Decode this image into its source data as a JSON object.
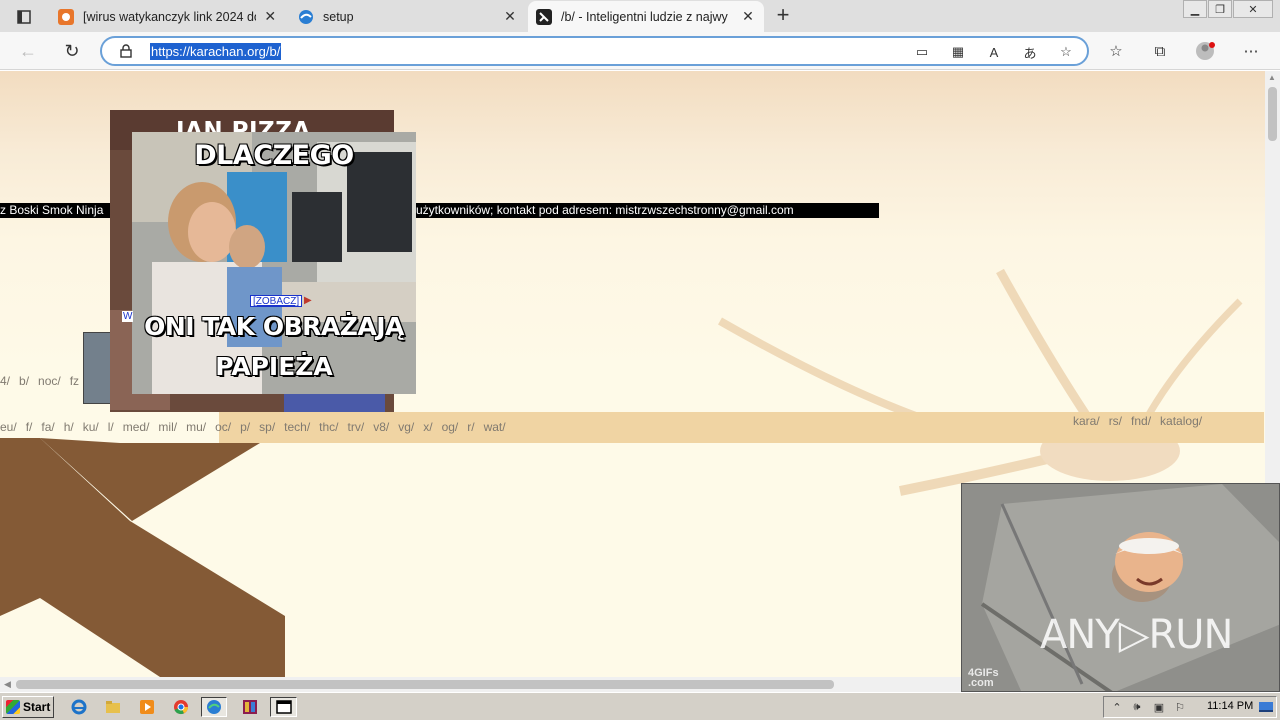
{
  "browser": {
    "tabs": [
      {
        "title": "[wirus watykanczyk link 2024 do",
        "active": false
      },
      {
        "title": "setup",
        "active": false
      },
      {
        "title": "/b/ - Inteligentni ludzie z najwy",
        "active": true
      }
    ],
    "new_tab_label": "+",
    "address": "https://karachan.org/b/"
  },
  "page": {
    "banner_left": "z Boski Smok Ninja",
    "banner_right": "użytkowników; kontakt pod adresem: mistrzwszechstronny@gmail.com",
    "nav_row1": [
      "4/",
      "b/",
      "noc/",
      "fz"
    ],
    "nav_row2": [
      "eu/",
      "f/",
      "fa/",
      "h/",
      "ku/",
      "l/",
      "med/",
      "mil/",
      "mu/",
      "oc/",
      "p/",
      "sp/",
      "tech/",
      "thc/",
      "trv/",
      "v8/",
      "vg/",
      "x/",
      "og/",
      "r/",
      "wat/"
    ],
    "nav_right": [
      "kara/",
      "rs/",
      "fnd/",
      "katalog/"
    ],
    "back_image_text": "JAN PIZZA DRUGI",
    "meme_top": "DLACZEGO",
    "meme_bottom_1": "ONI TAK OBRAŻAJĄ",
    "meme_bottom_2": "PAPIEŻA",
    "zobacz_link": "[ZOBACZ]",
    "w_link": "W",
    "gif_watermark_1": "4GIFs",
    "gif_watermark_2": ".com",
    "gif_logo": "ANY▷RUN"
  },
  "taskbar": {
    "start_label": "Start",
    "clock": "11:14 PM"
  }
}
